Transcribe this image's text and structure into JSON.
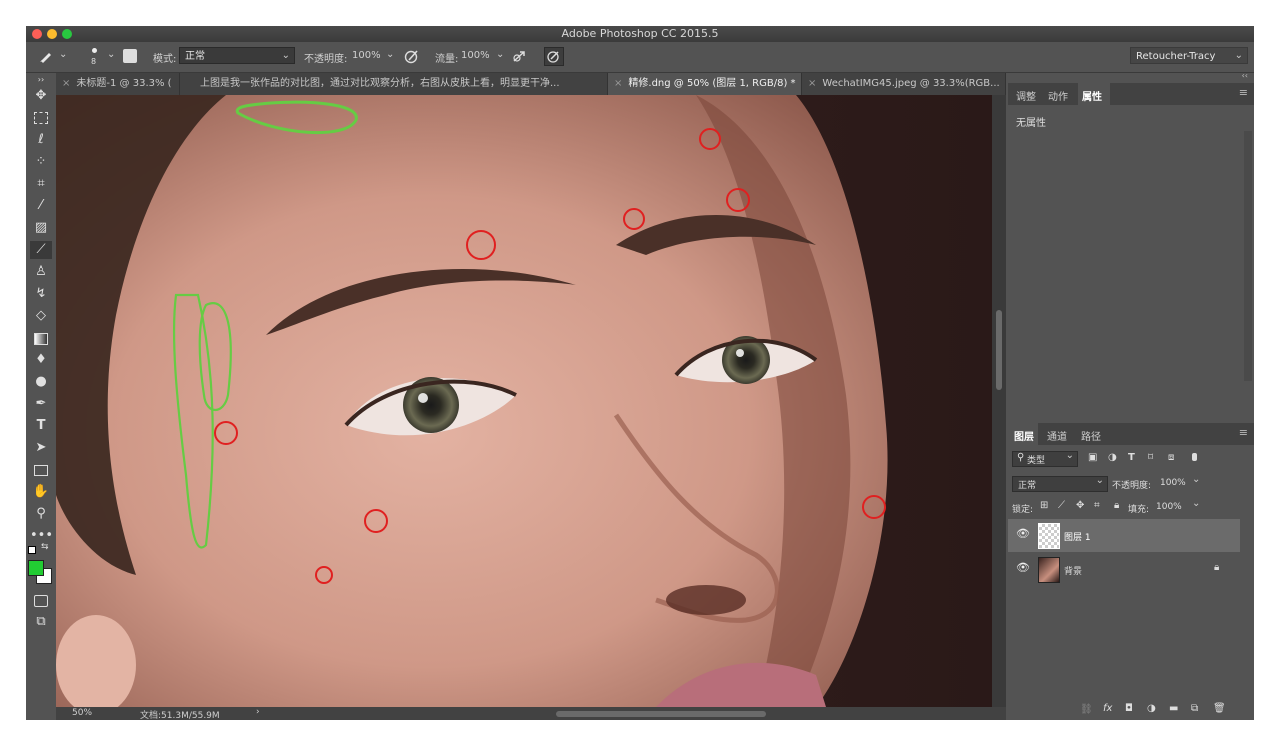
{
  "app": {
    "title": "Adobe Photoshop CC 2015.5"
  },
  "options": {
    "brush_size": "8",
    "mode_label": "模式:",
    "mode_value": "正常",
    "opacity_label": "不透明度:",
    "opacity_value": "100%",
    "flow_label": "流量:",
    "flow_value": "100%",
    "workspace": "Retoucher-Tracy"
  },
  "tabs": [
    {
      "label": "未标题-1 @ 33.3% (",
      "active": false
    },
    {
      "label": "上图是我一张作品的对比图，通过对比观察分析，右图从皮肤上看，明显更干净...",
      "active": false
    },
    {
      "label": "精修.dng @ 50% (图层 1, RGB/8) *",
      "active": true
    },
    {
      "label": "WechatIMG45.jpeg @ 33.3%(RGB...",
      "active": false
    }
  ],
  "status": {
    "zoom": "50%",
    "doc": "文档:51.3M/55.9M",
    "arrow": "›"
  },
  "properties_panel": {
    "tabs": [
      "调整",
      "动作",
      "属性"
    ],
    "active_tab": "属性",
    "content": "无属性"
  },
  "layers_panel": {
    "tabs": [
      "图层",
      "通道",
      "路径"
    ],
    "filter_label": "类型",
    "blend_mode": "正常",
    "opacity_label": "不透明度:",
    "opacity_value": "100%",
    "lock_label": "锁定:",
    "fill_label": "填充:",
    "fill_value": "100%",
    "layers": [
      {
        "name": "图层 1",
        "selected": true
      },
      {
        "name": "背景",
        "selected": false
      }
    ]
  },
  "colors": {
    "foreground": "#22cc33",
    "background": "#ffffff",
    "annotation_red": "#e02020",
    "annotation_green": "#66cc44",
    "accent_bg": "#535353"
  },
  "icons": [
    "brush-icon",
    "move-icon",
    "marquee-icon",
    "lasso-icon",
    "quick-select-icon",
    "crop-icon",
    "eyedropper-icon",
    "healing-icon",
    "brush-tool-icon",
    "stamp-icon",
    "history-brush-icon",
    "eraser-icon",
    "gradient-icon",
    "blur-icon",
    "dodge-icon",
    "pen-icon",
    "type-icon",
    "path-select-icon",
    "rectangle-icon",
    "hand-icon",
    "zoom-icon",
    "more-icon"
  ]
}
